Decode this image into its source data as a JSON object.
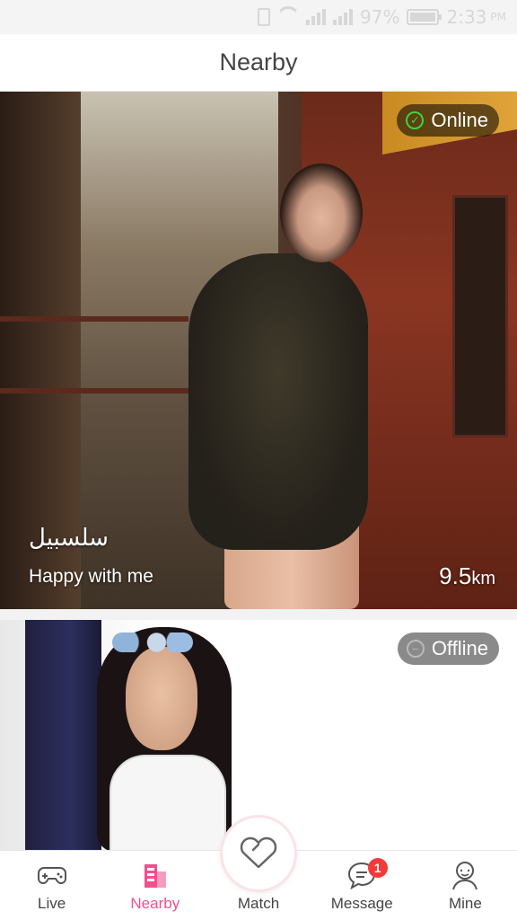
{
  "status_bar": {
    "battery": "97%",
    "time": "2:33",
    "ampm": "PM",
    "battery_level": 0.97
  },
  "header": {
    "title": "Nearby"
  },
  "cards": [
    {
      "status": "Online",
      "name": "سلسبيل",
      "bio": "Happy with me",
      "distance_value": "9.5",
      "distance_unit": "km"
    },
    {
      "status": "Offline"
    }
  ],
  "bottom_nav": {
    "items": [
      {
        "label": "Live",
        "icon": "gamepad-icon"
      },
      {
        "label": "Nearby",
        "icon": "buildings-icon",
        "active": true
      },
      {
        "label": "Match",
        "icon": "heart-icon"
      },
      {
        "label": "Message",
        "icon": "chat-bubble-icon",
        "badge": "1"
      },
      {
        "label": "Mine",
        "icon": "person-icon"
      }
    ]
  },
  "colors": {
    "accent": "#f24f8f",
    "online": "#3fd13f",
    "badge": "#f33a3a"
  }
}
